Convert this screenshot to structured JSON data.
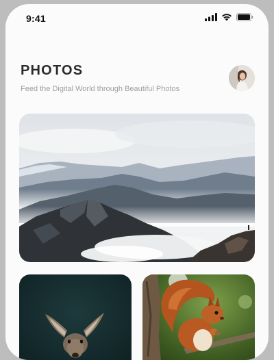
{
  "status_bar": {
    "time": "9:41",
    "icons": [
      "cellular-signal-icon",
      "wifi-icon",
      "battery-icon"
    ]
  },
  "header": {
    "title": "PHOTOS",
    "subtitle": "Feed the Digital World through Beautiful Photos"
  },
  "profile": {
    "avatar_icon": "user-avatar"
  },
  "gallery": {
    "photos": [
      {
        "subject": "misty mountain range"
      },
      {
        "subject": "deer with large ears"
      },
      {
        "subject": "red squirrel on branch"
      }
    ]
  },
  "colors": {
    "background": "#fbfbfb",
    "title": "#2b2b2b",
    "subtitle": "#9e9e9e"
  }
}
